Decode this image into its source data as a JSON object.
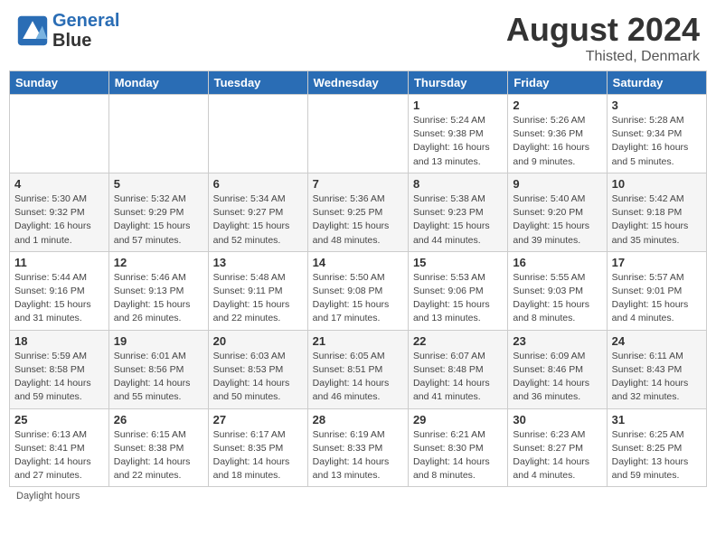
{
  "header": {
    "logo_line1": "General",
    "logo_line2": "Blue",
    "main_title": "August 2024",
    "subtitle": "Thisted, Denmark"
  },
  "days_of_week": [
    "Sunday",
    "Monday",
    "Tuesday",
    "Wednesday",
    "Thursday",
    "Friday",
    "Saturday"
  ],
  "footer": {
    "daylight_label": "Daylight hours"
  },
  "weeks": [
    {
      "days": [
        {
          "num": "",
          "info": ""
        },
        {
          "num": "",
          "info": ""
        },
        {
          "num": "",
          "info": ""
        },
        {
          "num": "",
          "info": ""
        },
        {
          "num": "1",
          "info": "Sunrise: 5:24 AM\nSunset: 9:38 PM\nDaylight: 16 hours\nand 13 minutes."
        },
        {
          "num": "2",
          "info": "Sunrise: 5:26 AM\nSunset: 9:36 PM\nDaylight: 16 hours\nand 9 minutes."
        },
        {
          "num": "3",
          "info": "Sunrise: 5:28 AM\nSunset: 9:34 PM\nDaylight: 16 hours\nand 5 minutes."
        }
      ]
    },
    {
      "days": [
        {
          "num": "4",
          "info": "Sunrise: 5:30 AM\nSunset: 9:32 PM\nDaylight: 16 hours\nand 1 minute."
        },
        {
          "num": "5",
          "info": "Sunrise: 5:32 AM\nSunset: 9:29 PM\nDaylight: 15 hours\nand 57 minutes."
        },
        {
          "num": "6",
          "info": "Sunrise: 5:34 AM\nSunset: 9:27 PM\nDaylight: 15 hours\nand 52 minutes."
        },
        {
          "num": "7",
          "info": "Sunrise: 5:36 AM\nSunset: 9:25 PM\nDaylight: 15 hours\nand 48 minutes."
        },
        {
          "num": "8",
          "info": "Sunrise: 5:38 AM\nSunset: 9:23 PM\nDaylight: 15 hours\nand 44 minutes."
        },
        {
          "num": "9",
          "info": "Sunrise: 5:40 AM\nSunset: 9:20 PM\nDaylight: 15 hours\nand 39 minutes."
        },
        {
          "num": "10",
          "info": "Sunrise: 5:42 AM\nSunset: 9:18 PM\nDaylight: 15 hours\nand 35 minutes."
        }
      ]
    },
    {
      "days": [
        {
          "num": "11",
          "info": "Sunrise: 5:44 AM\nSunset: 9:16 PM\nDaylight: 15 hours\nand 31 minutes."
        },
        {
          "num": "12",
          "info": "Sunrise: 5:46 AM\nSunset: 9:13 PM\nDaylight: 15 hours\nand 26 minutes."
        },
        {
          "num": "13",
          "info": "Sunrise: 5:48 AM\nSunset: 9:11 PM\nDaylight: 15 hours\nand 22 minutes."
        },
        {
          "num": "14",
          "info": "Sunrise: 5:50 AM\nSunset: 9:08 PM\nDaylight: 15 hours\nand 17 minutes."
        },
        {
          "num": "15",
          "info": "Sunrise: 5:53 AM\nSunset: 9:06 PM\nDaylight: 15 hours\nand 13 minutes."
        },
        {
          "num": "16",
          "info": "Sunrise: 5:55 AM\nSunset: 9:03 PM\nDaylight: 15 hours\nand 8 minutes."
        },
        {
          "num": "17",
          "info": "Sunrise: 5:57 AM\nSunset: 9:01 PM\nDaylight: 15 hours\nand 4 minutes."
        }
      ]
    },
    {
      "days": [
        {
          "num": "18",
          "info": "Sunrise: 5:59 AM\nSunset: 8:58 PM\nDaylight: 14 hours\nand 59 minutes."
        },
        {
          "num": "19",
          "info": "Sunrise: 6:01 AM\nSunset: 8:56 PM\nDaylight: 14 hours\nand 55 minutes."
        },
        {
          "num": "20",
          "info": "Sunrise: 6:03 AM\nSunset: 8:53 PM\nDaylight: 14 hours\nand 50 minutes."
        },
        {
          "num": "21",
          "info": "Sunrise: 6:05 AM\nSunset: 8:51 PM\nDaylight: 14 hours\nand 46 minutes."
        },
        {
          "num": "22",
          "info": "Sunrise: 6:07 AM\nSunset: 8:48 PM\nDaylight: 14 hours\nand 41 minutes."
        },
        {
          "num": "23",
          "info": "Sunrise: 6:09 AM\nSunset: 8:46 PM\nDaylight: 14 hours\nand 36 minutes."
        },
        {
          "num": "24",
          "info": "Sunrise: 6:11 AM\nSunset: 8:43 PM\nDaylight: 14 hours\nand 32 minutes."
        }
      ]
    },
    {
      "days": [
        {
          "num": "25",
          "info": "Sunrise: 6:13 AM\nSunset: 8:41 PM\nDaylight: 14 hours\nand 27 minutes."
        },
        {
          "num": "26",
          "info": "Sunrise: 6:15 AM\nSunset: 8:38 PM\nDaylight: 14 hours\nand 22 minutes."
        },
        {
          "num": "27",
          "info": "Sunrise: 6:17 AM\nSunset: 8:35 PM\nDaylight: 14 hours\nand 18 minutes."
        },
        {
          "num": "28",
          "info": "Sunrise: 6:19 AM\nSunset: 8:33 PM\nDaylight: 14 hours\nand 13 minutes."
        },
        {
          "num": "29",
          "info": "Sunrise: 6:21 AM\nSunset: 8:30 PM\nDaylight: 14 hours\nand 8 minutes."
        },
        {
          "num": "30",
          "info": "Sunrise: 6:23 AM\nSunset: 8:27 PM\nDaylight: 14 hours\nand 4 minutes."
        },
        {
          "num": "31",
          "info": "Sunrise: 6:25 AM\nSunset: 8:25 PM\nDaylight: 13 hours\nand 59 minutes."
        }
      ]
    }
  ]
}
